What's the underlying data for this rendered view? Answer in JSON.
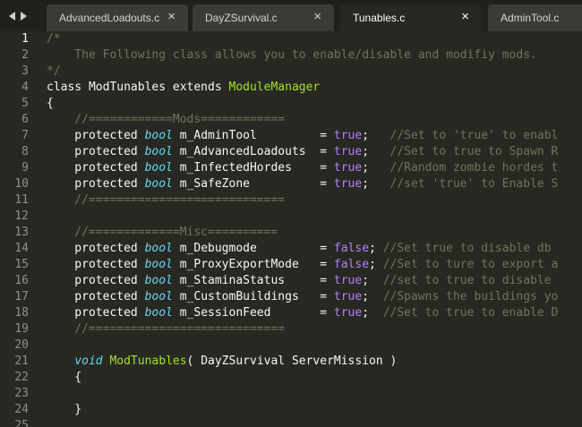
{
  "tabs": [
    {
      "name": "AdvancedLoadouts.c",
      "close": "×",
      "active": false
    },
    {
      "name": "DayZSurvival.c",
      "close": "×",
      "active": false
    },
    {
      "name": "Tunables.c",
      "close": "×",
      "active": true
    },
    {
      "name": "AdminTool.c",
      "close": "",
      "active": false
    }
  ],
  "editor": {
    "current_line": 1,
    "colors": {
      "background": "#272822",
      "text": "#f8f8f2",
      "comment": "#75715e",
      "type": "#66d9ef",
      "constant": "#ae81ff",
      "class_name": "#a6e22e"
    },
    "lines": [
      {
        "n": "1",
        "tokens": [
          [
            "comment",
            "/*"
          ]
        ]
      },
      {
        "n": "2",
        "tokens": [
          [
            "comment",
            "    The Following class allows you to enable/disable and modifiy mods."
          ]
        ]
      },
      {
        "n": "3",
        "tokens": [
          [
            "comment",
            "*/"
          ]
        ]
      },
      {
        "n": "4",
        "tokens": [
          [
            "plain",
            "class ModTunables extends "
          ],
          [
            "class",
            "ModuleManager"
          ]
        ]
      },
      {
        "n": "5",
        "tokens": [
          [
            "plain",
            "{"
          ]
        ]
      },
      {
        "n": "6",
        "tokens": [
          [
            "comment",
            "    //============Mods============"
          ]
        ]
      },
      {
        "n": "7",
        "tokens": [
          [
            "plain",
            "    protected "
          ],
          [
            "type",
            "bool"
          ],
          [
            "plain",
            " m_AdminTool         = "
          ],
          [
            "const",
            "true"
          ],
          [
            "plain",
            ";   "
          ],
          [
            "comment",
            "//Set to 'true' to enabl"
          ]
        ]
      },
      {
        "n": "8",
        "tokens": [
          [
            "plain",
            "    protected "
          ],
          [
            "type",
            "bool"
          ],
          [
            "plain",
            " m_AdvancedLoadouts  = "
          ],
          [
            "const",
            "true"
          ],
          [
            "plain",
            ";   "
          ],
          [
            "comment",
            "//Set to true to Spawn R"
          ]
        ]
      },
      {
        "n": "9",
        "tokens": [
          [
            "plain",
            "    protected "
          ],
          [
            "type",
            "bool"
          ],
          [
            "plain",
            " m_InfectedHordes    = "
          ],
          [
            "const",
            "true"
          ],
          [
            "plain",
            ";   "
          ],
          [
            "comment",
            "//Random zombie hordes t"
          ]
        ]
      },
      {
        "n": "10",
        "tokens": [
          [
            "plain",
            "    protected "
          ],
          [
            "type",
            "bool"
          ],
          [
            "plain",
            " m_SafeZone          = "
          ],
          [
            "const",
            "true"
          ],
          [
            "plain",
            ";   "
          ],
          [
            "comment",
            "//set 'true' to Enable S"
          ]
        ]
      },
      {
        "n": "11",
        "tokens": [
          [
            "comment",
            "    //============================"
          ]
        ]
      },
      {
        "n": "12",
        "tokens": []
      },
      {
        "n": "13",
        "tokens": [
          [
            "comment",
            "    //=============Misc=========="
          ]
        ]
      },
      {
        "n": "14",
        "tokens": [
          [
            "plain",
            "    protected "
          ],
          [
            "type",
            "bool"
          ],
          [
            "plain",
            " m_Debugmode         = "
          ],
          [
            "const",
            "false"
          ],
          [
            "plain",
            "; "
          ],
          [
            "comment",
            "//Set true to disable db"
          ]
        ]
      },
      {
        "n": "15",
        "tokens": [
          [
            "plain",
            "    protected "
          ],
          [
            "type",
            "bool"
          ],
          [
            "plain",
            " m_ProxyExportMode   = "
          ],
          [
            "const",
            "false"
          ],
          [
            "plain",
            "; "
          ],
          [
            "comment",
            "//Set to ture to export a"
          ]
        ]
      },
      {
        "n": "16",
        "tokens": [
          [
            "plain",
            "    protected "
          ],
          [
            "type",
            "bool"
          ],
          [
            "plain",
            " m_StaminaStatus     = "
          ],
          [
            "const",
            "true"
          ],
          [
            "plain",
            ";  "
          ],
          [
            "comment",
            "//set to true to disable"
          ]
        ]
      },
      {
        "n": "17",
        "tokens": [
          [
            "plain",
            "    protected "
          ],
          [
            "type",
            "bool"
          ],
          [
            "plain",
            " m_CustomBuildings   = "
          ],
          [
            "const",
            "true"
          ],
          [
            "plain",
            ";  "
          ],
          [
            "comment",
            "//Spawns the buildings yo"
          ]
        ]
      },
      {
        "n": "18",
        "tokens": [
          [
            "plain",
            "    protected "
          ],
          [
            "type",
            "bool"
          ],
          [
            "plain",
            " m_SessionFeed       = "
          ],
          [
            "const",
            "true"
          ],
          [
            "plain",
            ";  "
          ],
          [
            "comment",
            "//Set to true to enable D"
          ]
        ]
      },
      {
        "n": "19",
        "tokens": [
          [
            "comment",
            "    //============================"
          ]
        ]
      },
      {
        "n": "20",
        "tokens": []
      },
      {
        "n": "21",
        "tokens": [
          [
            "plain",
            "    "
          ],
          [
            "type",
            "void"
          ],
          [
            "plain",
            " "
          ],
          [
            "func",
            "ModTunables"
          ],
          [
            "plain",
            "( DayZSurvival ServerMission )"
          ]
        ]
      },
      {
        "n": "22",
        "tokens": [
          [
            "plain",
            "    {"
          ]
        ]
      },
      {
        "n": "23",
        "tokens": []
      },
      {
        "n": "24",
        "tokens": [
          [
            "plain",
            "    }"
          ]
        ]
      },
      {
        "n": "25",
        "tokens": []
      }
    ]
  }
}
